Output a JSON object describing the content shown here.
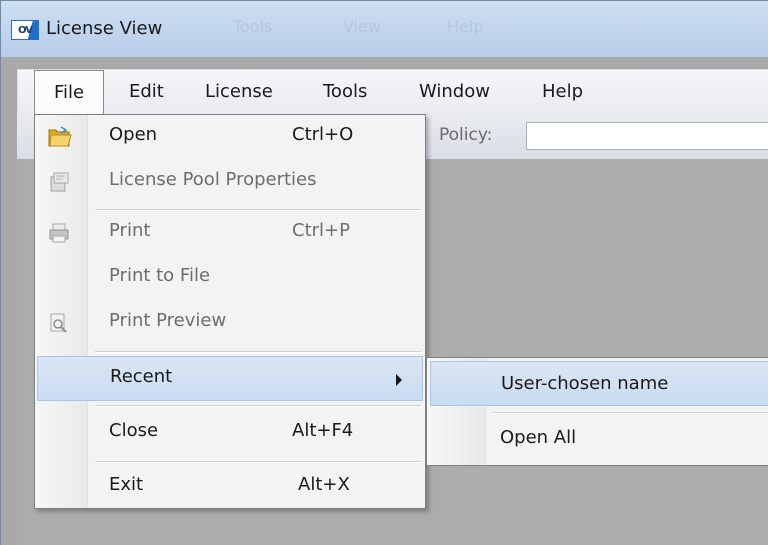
{
  "window": {
    "title": "License View",
    "app_icon_text": "OV",
    "title_ghost": [
      "Tools",
      "View",
      "Help"
    ]
  },
  "menubar": {
    "items": [
      "File",
      "Edit",
      "License",
      "Tools",
      "Window",
      "Help"
    ],
    "open_item": "File"
  },
  "toolbar": {
    "policy_label": "Policy:",
    "policy_value": ""
  },
  "file_menu": {
    "items": [
      {
        "label": "Open",
        "shortcut": "Ctrl+O",
        "icon": "open-folder-icon",
        "enabled": true
      },
      {
        "label": "License Pool Properties",
        "shortcut": "",
        "icon": "properties-icon",
        "enabled": false
      },
      {
        "label": "Print",
        "shortcut": "Ctrl+P",
        "icon": "printer-icon",
        "enabled": false
      },
      {
        "label": "Print to File",
        "shortcut": "",
        "icon": "",
        "enabled": false
      },
      {
        "label": "Print Preview",
        "shortcut": "",
        "icon": "print-preview-icon",
        "enabled": false
      },
      {
        "label": "Recent",
        "shortcut": "",
        "icon": "",
        "enabled": true,
        "submenu": true,
        "highlighted": true
      },
      {
        "label": "Close",
        "shortcut": "Alt+F4",
        "icon": "",
        "enabled": true
      },
      {
        "label": "Exit",
        "shortcut": "Alt+X",
        "icon": "",
        "enabled": true
      }
    ]
  },
  "recent_submenu": {
    "items": [
      {
        "label": "User-chosen name",
        "highlighted": true
      },
      {
        "label": "Open All",
        "highlighted": false
      }
    ]
  },
  "colors": {
    "highlight": "#c9dbf1",
    "workspace": "#acacac",
    "menu_bg": "#f3f3f3"
  }
}
